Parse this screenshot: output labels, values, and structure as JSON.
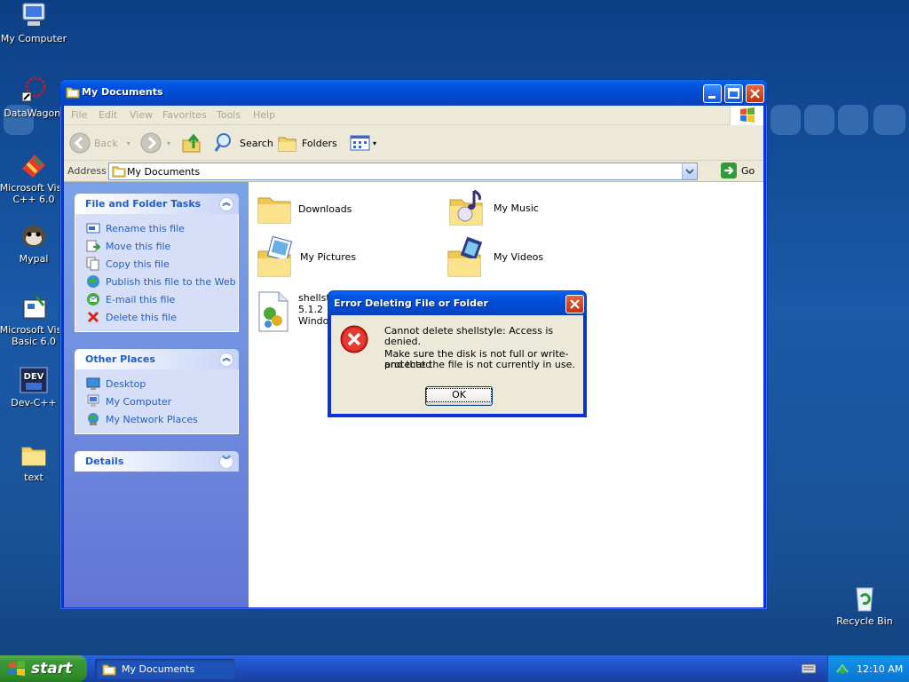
{
  "desktop": {
    "icons": [
      {
        "label": "My Computer",
        "icon": "my-computer-icon"
      },
      {
        "label": "DataWagon.",
        "icon": "datawagon-icon"
      },
      {
        "label": "Microsoft Visu C++ 6.0",
        "icon": "msvc-icon"
      },
      {
        "label": "Mypal",
        "icon": "mypal-icon"
      },
      {
        "label": "Microsoft Visu Basic 6.0",
        "icon": "vb6-icon"
      },
      {
        "label": "Dev-C++",
        "icon": "devcpp-icon"
      },
      {
        "label": "text",
        "icon": "folder-icon"
      },
      {
        "label": "Recycle Bin",
        "icon": "recycle-bin-icon"
      }
    ]
  },
  "window": {
    "title": "My Documents",
    "menu": [
      "File",
      "Edit",
      "View",
      "Favorites",
      "Tools",
      "Help"
    ],
    "toolbar": {
      "back": "Back",
      "search": "Search",
      "folders": "Folders"
    },
    "address": {
      "label": "Address",
      "value": "My Documents",
      "go": "Go"
    },
    "left_pane": {
      "file_tasks": {
        "title": "File and Folder Tasks",
        "items": [
          "Rename this file",
          "Move this file",
          "Copy this file",
          "Publish this file to the Web",
          "E-mail this file",
          "Delete this file"
        ]
      },
      "other_places": {
        "title": "Other Places",
        "items": [
          "Desktop",
          "My Computer",
          "My Network Places"
        ]
      },
      "details": {
        "title": "Details"
      }
    },
    "items": [
      {
        "label": "Downloads",
        "icon": "folder-icon"
      },
      {
        "label": "My Music",
        "icon": "music-folder-icon"
      },
      {
        "label": "My Pictures",
        "icon": "pictures-folder-icon"
      },
      {
        "label": "My Videos",
        "icon": "videos-folder-icon"
      },
      {
        "label_lines": [
          "shellst",
          "5.1.2",
          "Windo"
        ],
        "icon": "dll-file-icon"
      }
    ]
  },
  "dialog": {
    "title": "Error Deleting File or Folder",
    "message": "Cannot delete shellstyle: Access is denied.",
    "detail_line1": "Make sure the disk is not full or write-protected",
    "detail_line2": "and that the file is not currently in use.",
    "ok": "OK"
  },
  "taskbar": {
    "start": "start",
    "task": "My Documents",
    "clock": "12:10 AM"
  }
}
